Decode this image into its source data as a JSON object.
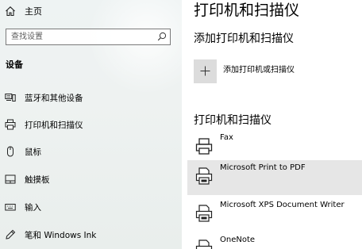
{
  "sidebar": {
    "home_label": "主页",
    "search_placeholder": "查找设置",
    "section_title": "设备",
    "items": [
      {
        "label": "蓝牙和其他设备",
        "icon": "bluetooth-devices-icon"
      },
      {
        "label": "打印机和扫描仪",
        "icon": "printer-icon"
      },
      {
        "label": "鼠标",
        "icon": "mouse-icon"
      },
      {
        "label": "触摸板",
        "icon": "touchpad-icon"
      },
      {
        "label": "输入",
        "icon": "keyboard-icon"
      },
      {
        "label": "笔和 Windows Ink",
        "icon": "pen-icon"
      }
    ]
  },
  "main": {
    "title": "打印机和扫描仪",
    "add_heading": "添加打印机和扫描仪",
    "add_label": "添加打印机或扫描仪",
    "list_heading": "打印机和扫描仪",
    "printers": [
      {
        "name": "Fax",
        "icon": "fax-icon"
      },
      {
        "name": "Microsoft Print to PDF",
        "icon": "printer-icon",
        "selected": true
      },
      {
        "name": "Microsoft XPS Document Writer",
        "icon": "printer-icon"
      },
      {
        "name": "OneNote",
        "icon": "printer-icon"
      }
    ]
  },
  "colors": {
    "sidebar_bg": "#eef2f1",
    "selected_row_bg": "#e6e6e6",
    "add_button_bg": "#dcdcdc"
  }
}
